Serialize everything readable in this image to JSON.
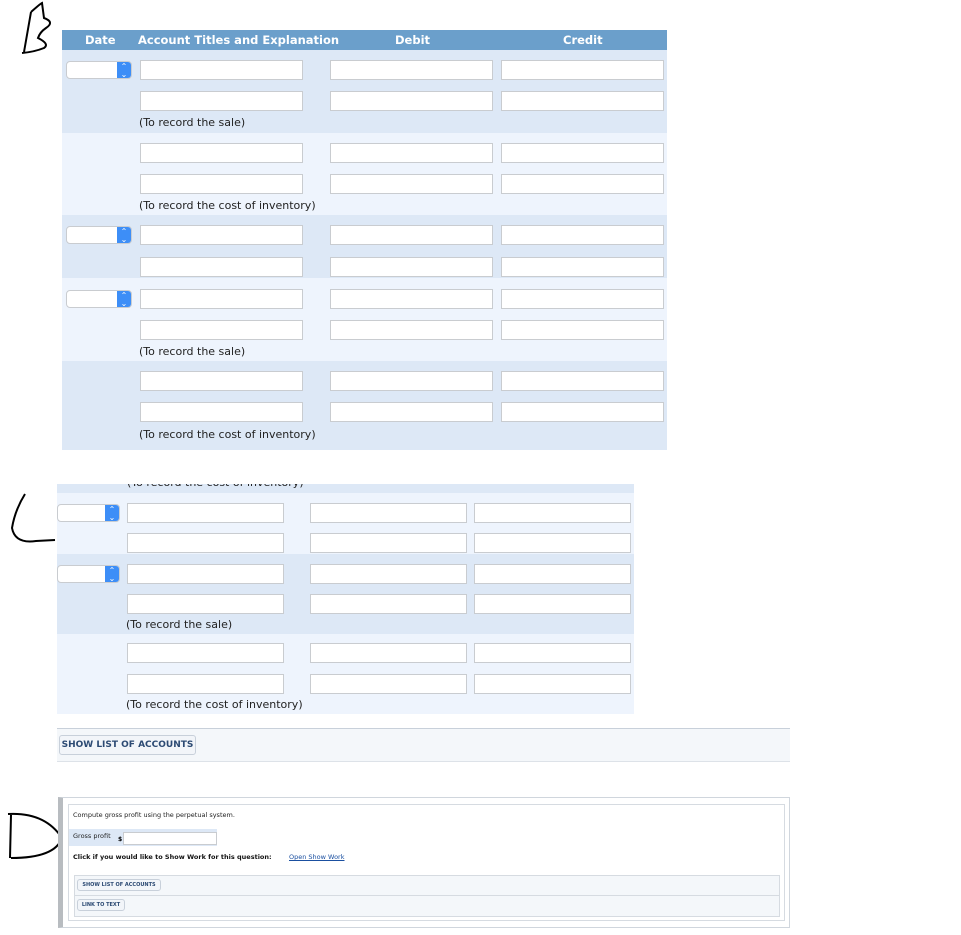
{
  "labels": {
    "b": "B",
    "c": "C",
    "d": "D"
  },
  "table": {
    "headers": {
      "date": "Date",
      "account": "Account Titles and Explanation",
      "debit": "Debit",
      "credit": "Credit"
    },
    "note_sale": "(To record the sale)",
    "note_cost": "(To record the cost of inventory)"
  },
  "section_c": {
    "show_accounts": "SHOW LIST OF ACCOUNTS"
  },
  "section_d": {
    "prompt": "Compute gross profit using the perpetual system.",
    "gross_profit_label": "Gross profit",
    "currency": "$",
    "show_work_text": "Click if you would like to Show Work for this question:",
    "show_work_link": "Open Show Work",
    "show_accounts": "SHOW LIST OF ACCOUNTS",
    "link_to_text": "LINK TO TEXT"
  },
  "colors": {
    "header": "#6b9fcb",
    "band_dark": "#dde8f6",
    "band_light": "#eef4fd",
    "select_arrow": "#3d8ef7",
    "link": "#1a4fa0"
  }
}
